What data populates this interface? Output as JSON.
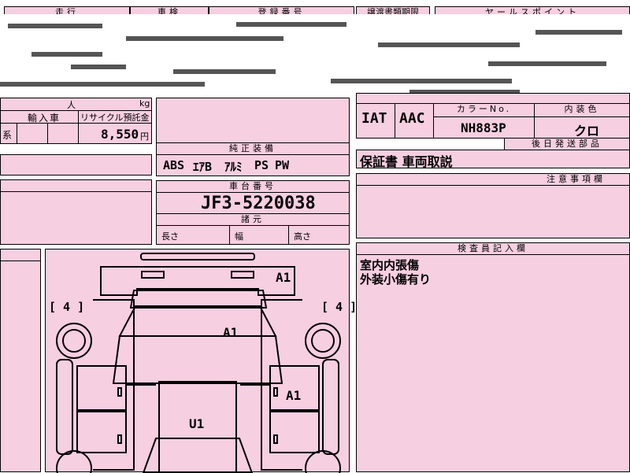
{
  "top": {
    "mileage_label": "走行",
    "inspection_label": "車検",
    "registration_label": "登録番号",
    "transfer_label": "譲渡書類期限",
    "sales_point_label": "ヤールスポイント"
  },
  "left": {
    "import_label": "輸入車",
    "recycle_label": "リサイクル預託金",
    "recycle_value": "8,550",
    "recycle_unit": "円",
    "kei_label": "系",
    "partial_unit_kg": "kg",
    "partial_unit_jin": "人"
  },
  "middle": {
    "equipment_label": "純正装備",
    "equipment_values": [
      "ABS",
      "ｴｱB",
      "ｱﾙﾐ",
      "PS",
      "PW"
    ],
    "chassis_label": "車台番号",
    "chassis_value": "JF3-5220038",
    "specs_label": "諸元",
    "length_label": "長さ",
    "width_label": "幅",
    "height_label": "高さ"
  },
  "right": {
    "transmission": "IAT",
    "aircon": "AAC",
    "color_no_label": "カラーNo.",
    "color_no_value": "NH883P",
    "interior_label": "内装色",
    "interior_value": "クロ",
    "later_parts_label": "後日発送部品",
    "later_parts_value": "保証書 車両取説",
    "notes_label": "注意事項欄",
    "inspector_label": "検査員記入欄",
    "inspector_lines": [
      "室内内張傷",
      "外装小傷有り"
    ]
  },
  "diagram": {
    "grade_left": "[ 4 ]",
    "grade_right": "[ 4 ]",
    "marks": {
      "front_bumper": "A1",
      "hood": "A1",
      "right_door": "A1",
      "roof": "U1"
    }
  }
}
